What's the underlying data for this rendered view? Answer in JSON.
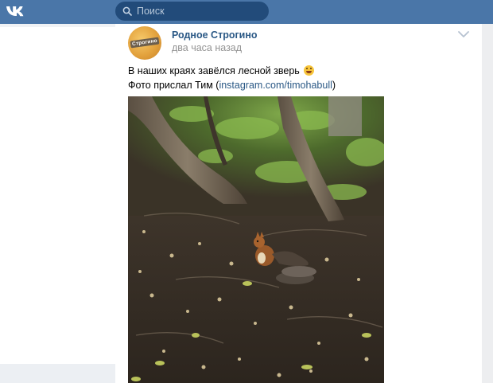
{
  "topbar": {
    "logo": "vk-logo",
    "search_placeholder": "Поиск"
  },
  "post": {
    "group_name": "Родное Строгино",
    "avatar_label": "Строгино",
    "time": "два часа назад",
    "text_line1": "В наших краях завёлся лесной зверь",
    "text_line2_prefix": "Фото прислал Тим (",
    "link_text": "instagram.com/timohabull",
    "text_line2_suffix": ")",
    "emoji": "grinning-face-emoji",
    "photo": "squirrel-in-park-photo"
  },
  "colors": {
    "header": "#4a76a8",
    "search_bg": "#224b7a",
    "link": "#2a5885",
    "meta": "#939393",
    "page_bg": "#edeef0"
  }
}
